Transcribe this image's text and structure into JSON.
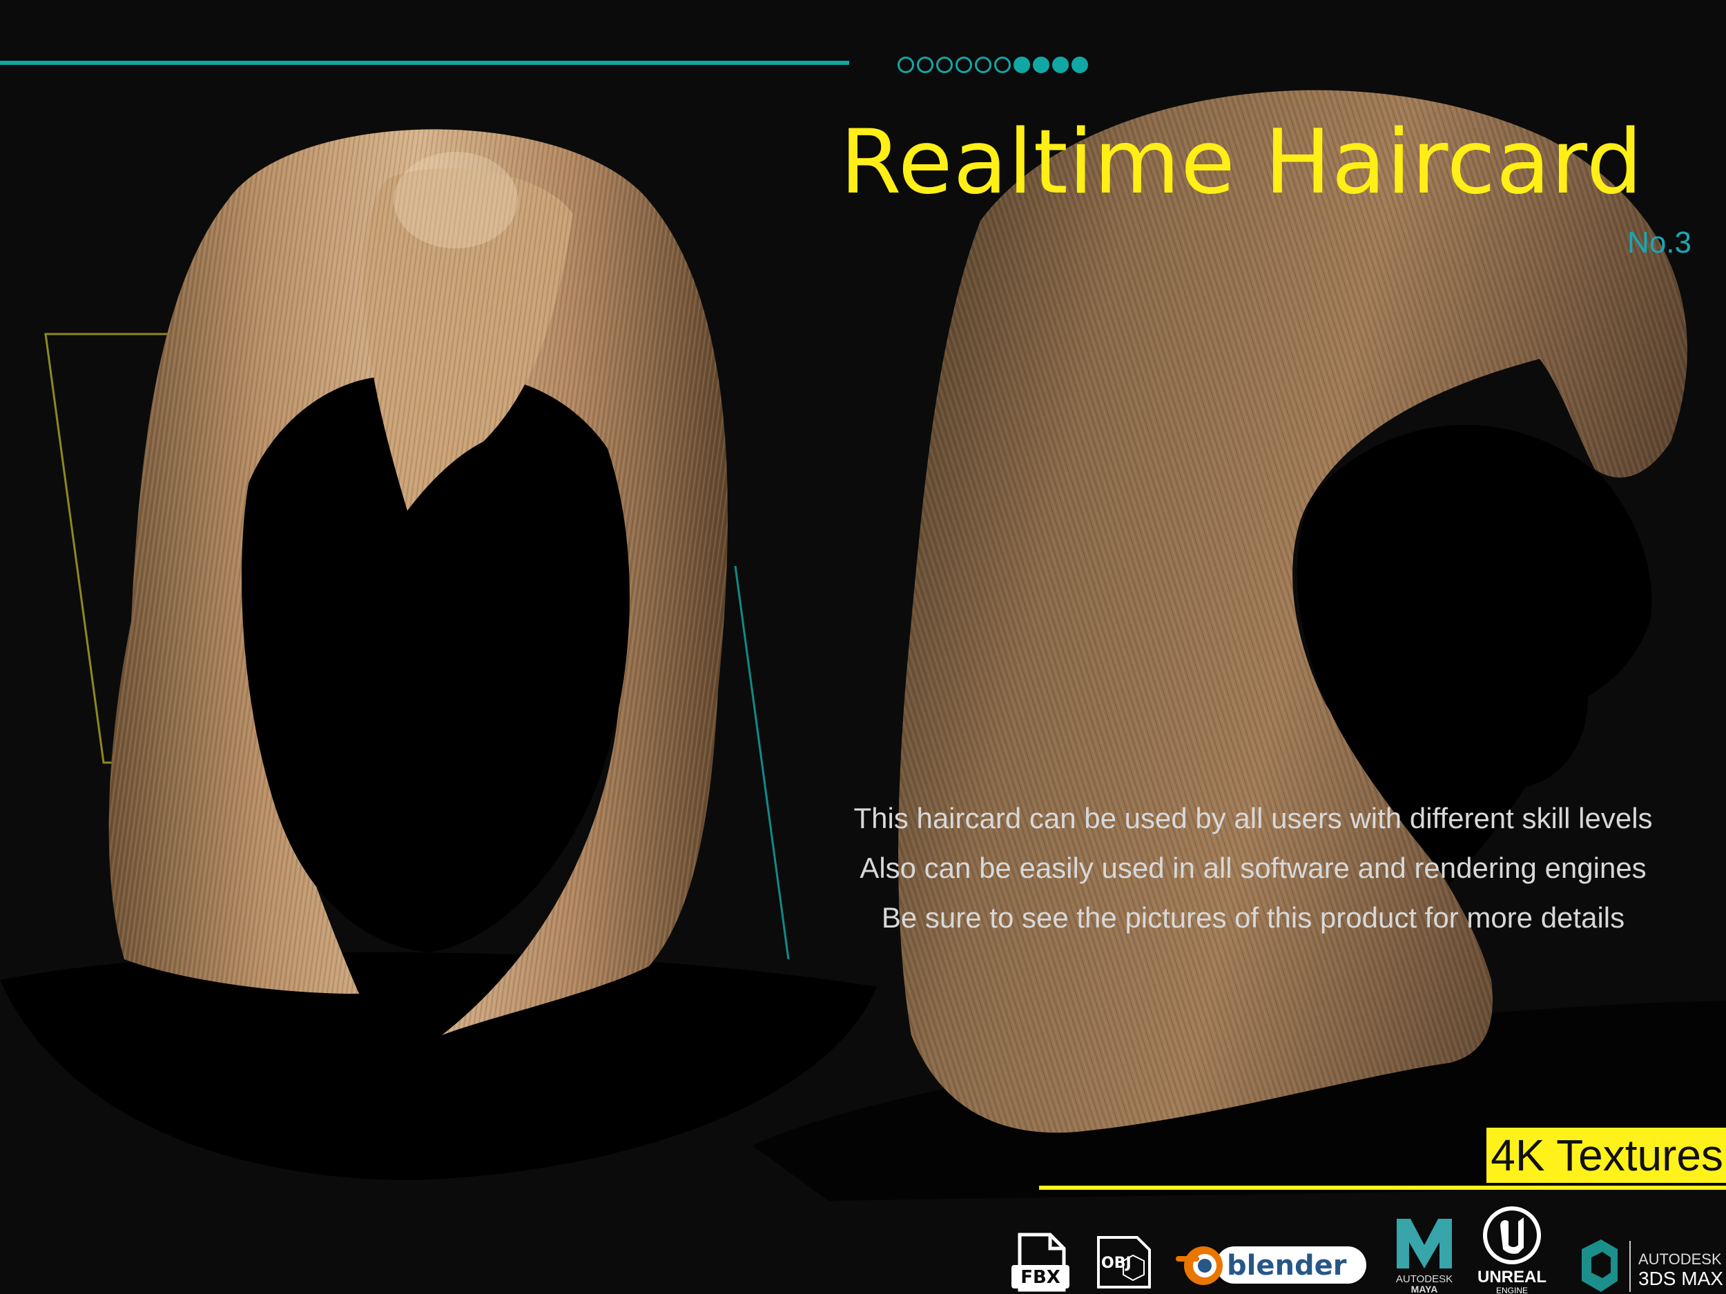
{
  "header": {
    "progress_dots": {
      "total": 10,
      "filled": 4
    },
    "title": "Realtime Haircard",
    "subtitle": "No.3"
  },
  "description": {
    "lines": [
      "This haircard can be used by all users with different skill levels",
      "Also can be easily used in all software and rendering engines",
      "Be sure to see the pictures of this product for more details"
    ]
  },
  "badge": {
    "label": "4K Textures"
  },
  "formats": {
    "fbx": "FBX",
    "obj": "OBJ",
    "blender": "blender",
    "maya_top": "AUTODESK",
    "maya_bottom": "MAYA",
    "unreal_top": "UNREAL",
    "unreal_bottom": "ENGINE",
    "max_top": "AUTODESK",
    "max_bottom": "3DS MAX"
  },
  "colors": {
    "accent_teal": "#11a7a4",
    "title_yellow": "#ffef17",
    "badge_yellow": "#fff21a",
    "background": "#0b0b0b",
    "hair_light": "#c9a176",
    "hair_dark": "#8a6a4a"
  }
}
